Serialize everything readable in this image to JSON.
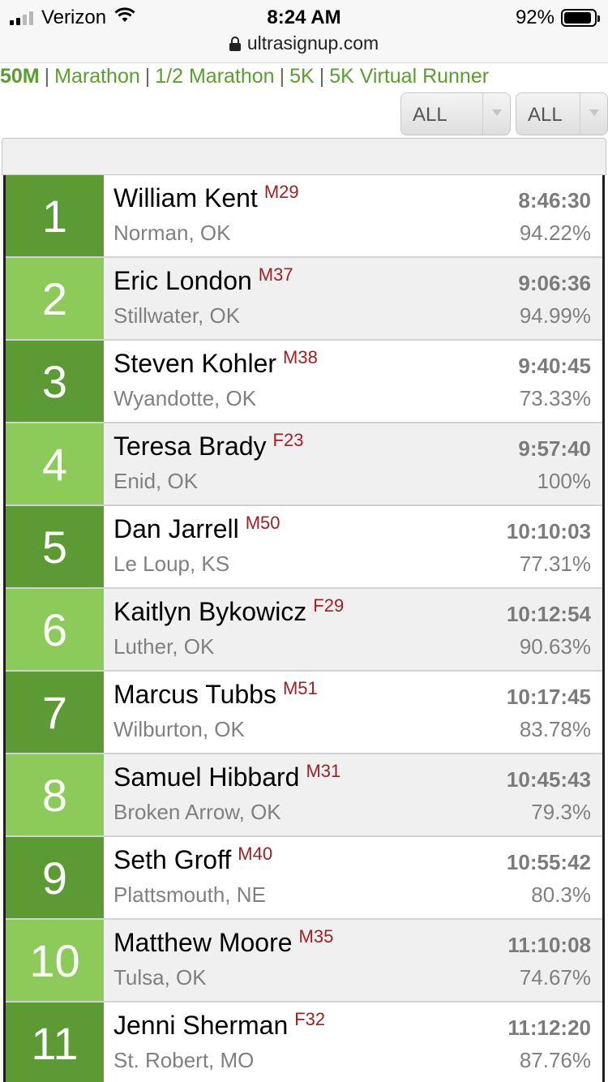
{
  "status_bar": {
    "carrier": "Verizon",
    "time": "8:24 AM",
    "battery": "92%",
    "battery_level": 0.92,
    "url": "ultrasignup.com"
  },
  "tabs": [
    {
      "label": "50M",
      "active": true
    },
    {
      "label": "Marathon",
      "active": false
    },
    {
      "label": "1/2 Marathon",
      "active": false
    },
    {
      "label": "5K",
      "active": false
    },
    {
      "label": "5K Virtual Runner",
      "active": false
    }
  ],
  "filters": {
    "gender": "ALL",
    "age": "ALL"
  },
  "colors": {
    "rank_dark": "#5c9a34",
    "rank_light": "#8ccb5a",
    "link": "#5a9e2f",
    "age_group": "#a12020"
  },
  "results": [
    {
      "rank": "1",
      "name": "William Kent",
      "age_group": "M29",
      "location": "Norman, OK",
      "time": "8:46:30",
      "percent": "94.22%"
    },
    {
      "rank": "2",
      "name": "Eric London",
      "age_group": "M37",
      "location": "Stillwater, OK",
      "time": "9:06:36",
      "percent": "94.99%"
    },
    {
      "rank": "3",
      "name": "Steven Kohler",
      "age_group": "M38",
      "location": "Wyandotte, OK",
      "time": "9:40:45",
      "percent": "73.33%"
    },
    {
      "rank": "4",
      "name": "Teresa Brady",
      "age_group": "F23",
      "location": "Enid, OK",
      "time": "9:57:40",
      "percent": "100%"
    },
    {
      "rank": "5",
      "name": "Dan Jarrell",
      "age_group": "M50",
      "location": "Le Loup, KS",
      "time": "10:10:03",
      "percent": "77.31%"
    },
    {
      "rank": "6",
      "name": "Kaitlyn Bykowicz",
      "age_group": "F29",
      "location": "Luther, OK",
      "time": "10:12:54",
      "percent": "90.63%"
    },
    {
      "rank": "7",
      "name": "Marcus Tubbs",
      "age_group": "M51",
      "location": "Wilburton, OK",
      "time": "10:17:45",
      "percent": "83.78%"
    },
    {
      "rank": "8",
      "name": "Samuel Hibbard",
      "age_group": "M31",
      "location": "Broken Arrow, OK",
      "time": "10:45:43",
      "percent": "79.3%"
    },
    {
      "rank": "9",
      "name": "Seth Groff",
      "age_group": "M40",
      "location": "Plattsmouth, NE",
      "time": "10:55:42",
      "percent": "80.3%"
    },
    {
      "rank": "10",
      "name": "Matthew Moore",
      "age_group": "M35",
      "location": "Tulsa, OK",
      "time": "11:10:08",
      "percent": "74.67%"
    },
    {
      "rank": "11",
      "name": "Jenni Sherman",
      "age_group": "F32",
      "location": "St. Robert, MO",
      "time": "11:12:20",
      "percent": "87.76%"
    }
  ]
}
